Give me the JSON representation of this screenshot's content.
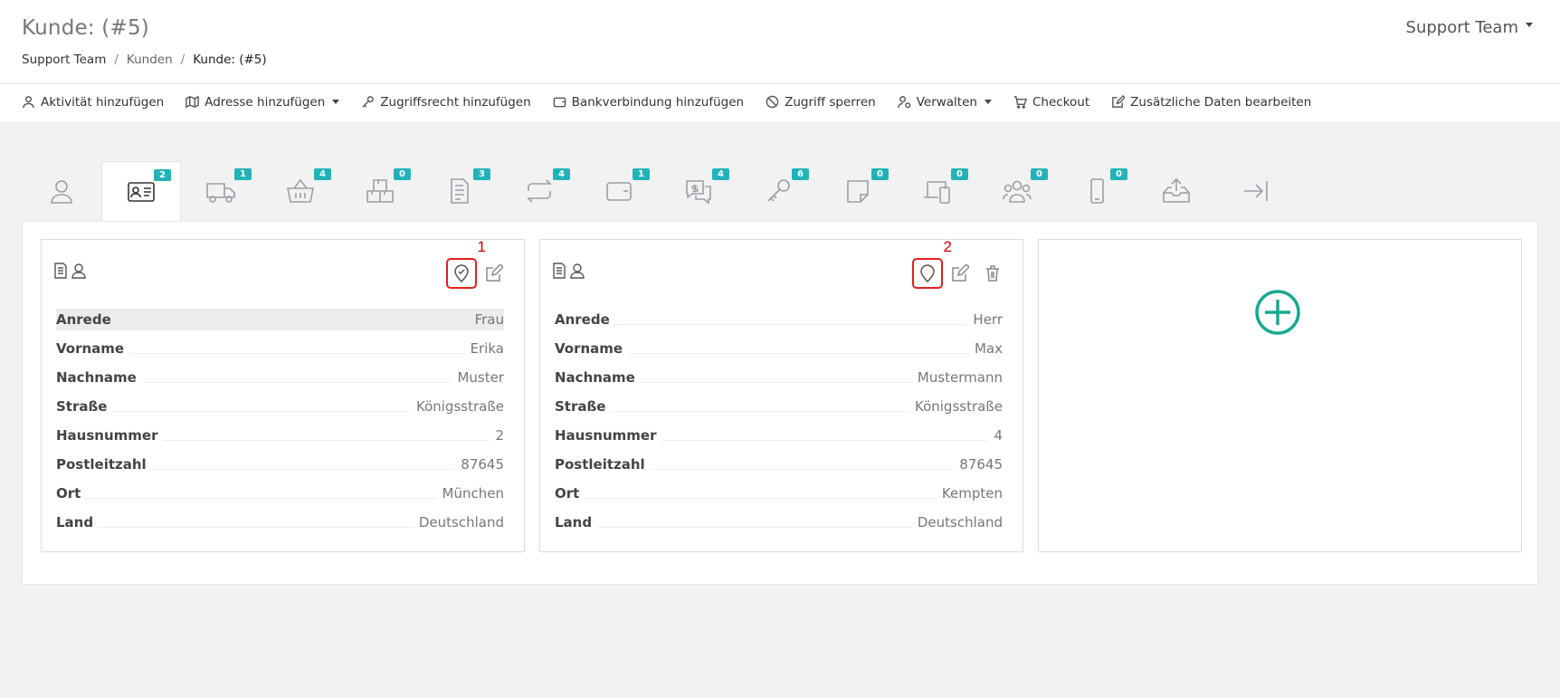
{
  "header": {
    "title": "Kunde: (#5)",
    "user_menu": "Support Team"
  },
  "breadcrumb": [
    {
      "label": "Support Team"
    },
    {
      "label": "Kunden"
    },
    {
      "label": "Kunde: (#5)"
    }
  ],
  "toolbar": {
    "activity": "Aktivität hinzufügen",
    "address": "Adresse hinzufügen",
    "access_right": "Zugriffsrecht hinzufügen",
    "bank": "Bankverbindung hinzufügen",
    "block": "Zugriff sperren",
    "manage": "Verwalten",
    "checkout": "Checkout",
    "extra_data": "Zusätzliche Daten bearbeiten"
  },
  "tabs": {
    "person": null,
    "addresses": "2",
    "shipping": "1",
    "basket": "4",
    "packages": "0",
    "documents": "3",
    "subscriptions": "4",
    "wallet": "1",
    "payments": "4",
    "keys": "6",
    "notes": "0",
    "devices": "0",
    "groups": "0",
    "mobile": "0",
    "upload": null,
    "login": null
  },
  "addresses": [
    {
      "marker": "1",
      "fields": [
        {
          "label": "Anrede",
          "value": "Frau"
        },
        {
          "label": "Vorname",
          "value": "Erika"
        },
        {
          "label": "Nachname",
          "value": "Muster"
        },
        {
          "label": "Straße",
          "value": "Königsstraße"
        },
        {
          "label": "Hausnummer",
          "value": "2"
        },
        {
          "label": "Postleitzahl",
          "value": "87645"
        },
        {
          "label": "Ort",
          "value": "München"
        },
        {
          "label": "Land",
          "value": "Deutschland"
        }
      ]
    },
    {
      "marker": "2",
      "fields": [
        {
          "label": "Anrede",
          "value": "Herr"
        },
        {
          "label": "Vorname",
          "value": "Max"
        },
        {
          "label": "Nachname",
          "value": "Mustermann"
        },
        {
          "label": "Straße",
          "value": "Königsstraße"
        },
        {
          "label": "Hausnummer",
          "value": "4"
        },
        {
          "label": "Postleitzahl",
          "value": "87645"
        },
        {
          "label": "Ort",
          "value": "Kempten"
        },
        {
          "label": "Land",
          "value": "Deutschland"
        }
      ]
    }
  ],
  "colors": {
    "badge": "#22b3b8",
    "add_button": "#1aa890",
    "highlight": "#e02020"
  }
}
